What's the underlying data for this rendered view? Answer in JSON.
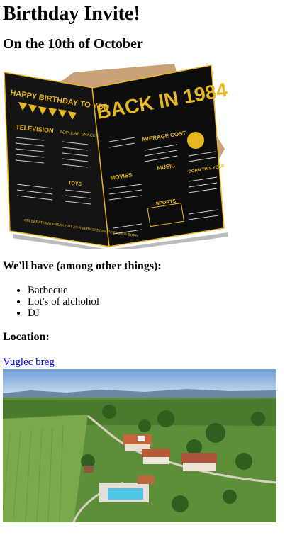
{
  "page": {
    "title": "Birthday Invite!",
    "date_heading": "On the 10th of October",
    "card_image": {
      "alt": "Back in 1984 birthday card",
      "left_panel_title": "HAPPY BIRTHDAY TO YOU",
      "right_panel_title": "BACK IN 1984",
      "sections": [
        "TELEVISION",
        "POPULAR SNACKS",
        "AVERAGE COST",
        "MUSIC",
        "MOVIES",
        "BORN THIS YEAR",
        "TOYS",
        "SPORTS"
      ],
      "footer": "CELEBRATIONS BREAK OUT AS A VERY SPECIAL PERSON IS BORN"
    },
    "have_heading": "We'll have (among other things):",
    "items": [
      "Barbecue",
      "Lot's of alchohol",
      "DJ"
    ],
    "location_heading": "Location:",
    "location_link": "Vuglec breg",
    "location_image_alt": "Aerial view of Vuglec breg",
    "colors": {
      "link": "#0000ee",
      "card_black": "#111111",
      "card_gold": "#e8b820"
    }
  }
}
